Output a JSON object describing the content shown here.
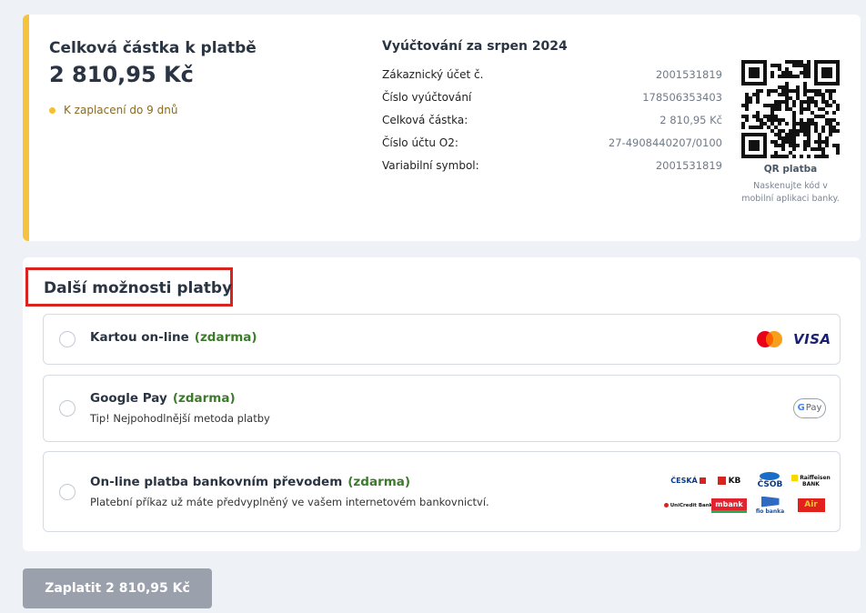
{
  "summary": {
    "total_label": "Celková částka k platbě",
    "total_amount": "2 810,95 Kč",
    "due_text": "K zaplacení do 9 dnů",
    "accent_color": "#f7c23d",
    "bill": {
      "title": "Vyúčtování za srpen 2024",
      "rows": [
        {
          "label": "Zákaznický účet č.",
          "value": "2001531819"
        },
        {
          "label": "Číslo vyúčtování",
          "value": "17850635340З"
        },
        {
          "label": "Celková částka:",
          "value": "2 810,95 Kč"
        },
        {
          "label": "Číslo účtu O2:",
          "value": "27-4908440207/0100"
        },
        {
          "label": "Variabilní symbol:",
          "value": "2001531819"
        }
      ]
    },
    "qr": {
      "title": "QR platba",
      "description": "Naskenujte kód v mobilní aplikaci banky."
    }
  },
  "options": {
    "title": "Další možnosti platby",
    "highlight_color": "#d9231f",
    "free_color": "#3d7a2c",
    "items": [
      {
        "title": "Kartou on-line",
        "free": "(zdarma)",
        "description": "",
        "logos": [
          "mastercard-icon",
          "visa-logo"
        ]
      },
      {
        "title": "Google Pay",
        "free": "(zdarma)",
        "description": "Tip! Nejpohodlnější metoda platby",
        "logos": [
          "google-pay-logo"
        ]
      },
      {
        "title": "On-line platba bankovním převodem",
        "free": "(zdarma)",
        "description": "Platební příkaz už máte předvyplněný ve vašem internetovém bankovnictví.",
        "logos": [
          "ceska-sporitelna-logo",
          "kb-logo",
          "csob-logo",
          "raiffeisen-logo",
          "unicredit-logo",
          "mbank-logo",
          "fio-logo",
          "air-bank-logo"
        ]
      }
    ],
    "card_logos": {
      "visa": "VISA"
    },
    "gpay_logo": {
      "g": "G",
      "text": "Pay"
    },
    "bank_logos": {
      "cs": "ČESKÁ",
      "kb": "KB",
      "csob": "ČSOB",
      "rb_line1": "Raiffeisen",
      "rb_line2": "BANK",
      "uc": "UniCredit Bank",
      "mb": "mbank",
      "fio": "fio banka",
      "ab": "Air"
    }
  },
  "pay_button": {
    "label": "Zaplatit 2 810,95 Kč",
    "color": "#9aa1ad"
  }
}
